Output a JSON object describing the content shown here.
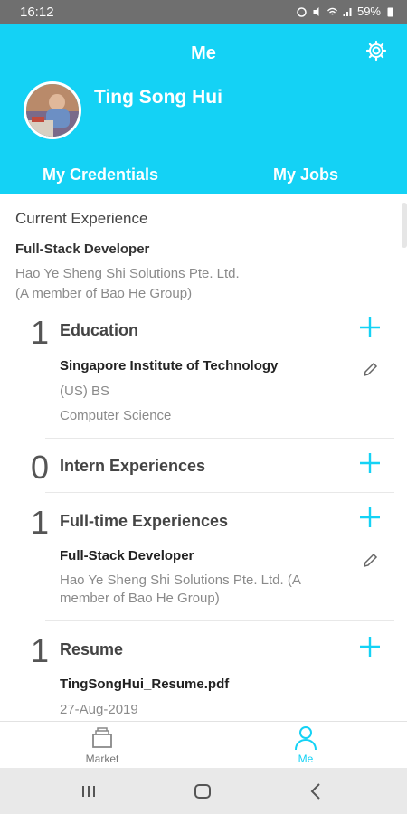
{
  "status_bar": {
    "time": "16:12",
    "battery": "59%"
  },
  "header": {
    "title": "Me",
    "user_name": "Ting Song Hui",
    "tabs": [
      {
        "label": "My Credentials"
      },
      {
        "label": "My Jobs"
      }
    ]
  },
  "current_experience": {
    "heading": "Current Experience",
    "role": "Full-Stack Developer",
    "company_line1": "Hao Ye Sheng Shi Solutions Pte. Ltd.",
    "company_line2": "(A member of Bao He Group)"
  },
  "sections": {
    "education": {
      "count": "1",
      "label": "Education",
      "item": {
        "school": "Singapore Institute of Technology",
        "degree": "(US) BS",
        "major": "Computer Science"
      }
    },
    "intern": {
      "count": "0",
      "label": "Intern Experiences"
    },
    "fulltime": {
      "count": "1",
      "label": "Full-time Experiences",
      "item": {
        "role": "Full-Stack Developer",
        "company_line1": "Hao Ye Sheng Shi Solutions Pte. Ltd. (A",
        "company_line2": "member of Bao He Group)"
      }
    },
    "resume": {
      "count": "1",
      "label": "Resume",
      "item": {
        "file": "TingSongHui_Resume.pdf",
        "date": "27-Aug-2019"
      }
    }
  },
  "bottom_nav": [
    {
      "label": "Market",
      "icon": "market-icon"
    },
    {
      "label": "Me",
      "icon": "person-icon"
    }
  ],
  "colors": {
    "accent": "#14d2f5",
    "status_bar": "#6f6f6f"
  }
}
